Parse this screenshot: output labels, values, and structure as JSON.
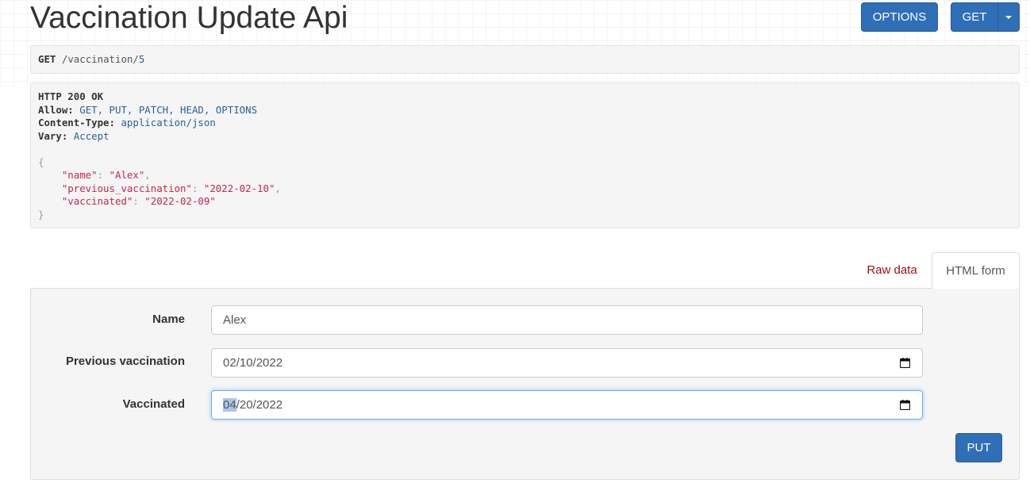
{
  "page": {
    "title": "Vaccination Update Api"
  },
  "toolbar": {
    "options_label": "OPTIONS",
    "get_label": "GET"
  },
  "request": {
    "method": "GET",
    "path": "/vaccination/",
    "id": "5"
  },
  "response": {
    "status": "HTTP 200 OK",
    "headers": [
      {
        "key": "Allow:",
        "value": "GET, PUT, PATCH, HEAD, OPTIONS"
      },
      {
        "key": "Content-Type:",
        "value": "application/json"
      },
      {
        "key": "Vary:",
        "value": "Accept"
      }
    ],
    "body": {
      "open": "{",
      "close": "}",
      "lines": [
        {
          "key": "\"name\"",
          "value": "\"Alex\"",
          "comma": ","
        },
        {
          "key": "\"previous_vaccination\"",
          "value": "\"2022-02-10\"",
          "comma": ","
        },
        {
          "key": "\"vaccinated\"",
          "value": "\"2022-02-09\"",
          "comma": ""
        }
      ]
    }
  },
  "tabs": {
    "raw": "Raw data",
    "html": "HTML form"
  },
  "form": {
    "name_label": "Name",
    "name_value": "Alex",
    "prev_label": "Previous vaccination",
    "prev_value": "02/10/2022",
    "vacc_label": "Vaccinated",
    "vacc_selected": "04",
    "vacc_rest": "/20/2022",
    "submit_label": "PUT"
  }
}
